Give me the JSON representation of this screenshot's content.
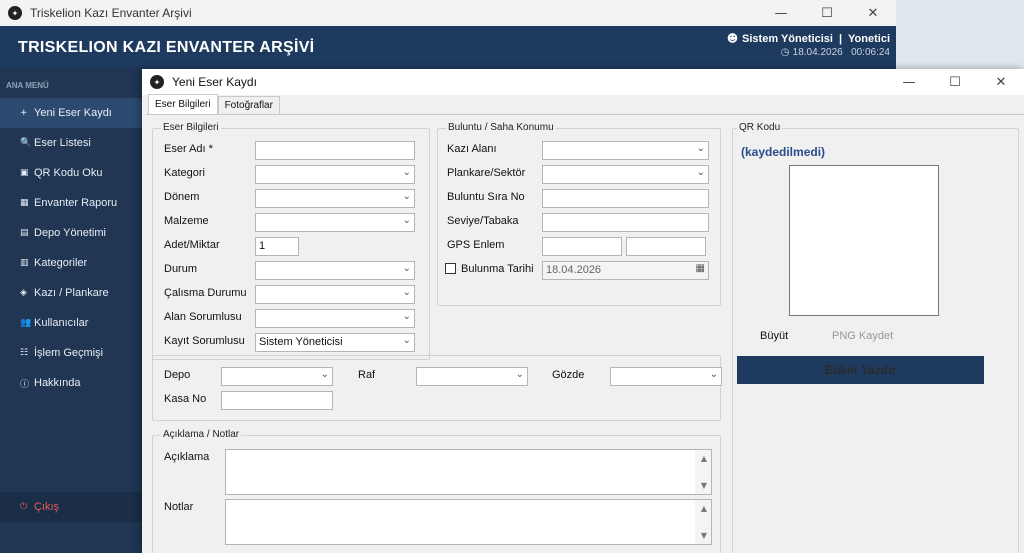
{
  "main_window": {
    "title": "Triskelion Kazı Envanter Arşivi",
    "header_title": "TRISKELION KAZI ENVANTER ARŞİVİ",
    "user_line": "Sistem Yöneticisi  |  Yonetici",
    "date": "18.04.2026",
    "time": "00:06:24",
    "controls": [
      "—",
      "☐",
      "✕"
    ]
  },
  "sidebar": {
    "heading": "ANA MENÜ",
    "items": [
      {
        "icon": "+",
        "label": "Yeni Eser Kaydı"
      },
      {
        "icon": "🔍",
        "label": "Eser Listesi"
      },
      {
        "icon": "▣",
        "label": "QR Kodu Oku"
      },
      {
        "icon": "▦",
        "label": "Envanter Raporu"
      },
      {
        "icon": "▤",
        "label": "Depo Yönetimi"
      },
      {
        "icon": "▥",
        "label": "Kategoriler"
      },
      {
        "icon": "◈",
        "label": "Kazı / Plankare"
      },
      {
        "icon": "👥",
        "label": "Kullanıcılar"
      },
      {
        "icon": "☷",
        "label": "İşlem Geçmişi"
      },
      {
        "icon": "ⓘ",
        "label": "Hakkında"
      }
    ],
    "exit": {
      "icon": "⏻",
      "label": "Çıkış"
    }
  },
  "dialog": {
    "title": "Yeni Eser Kaydı",
    "controls": [
      "—",
      "☐",
      "✕"
    ],
    "tabs": [
      "Eser Bilgileri",
      "Fotoğraflar"
    ],
    "eser_bilgileri": {
      "group_label": "Eser Bilgileri",
      "eser_adi": "Eser Adı *",
      "kategori": "Kategori",
      "donem": "Dönem",
      "malzeme": "Malzeme",
      "adet": "Adet/Miktar",
      "adet_value": "1",
      "durum": "Durum",
      "calisma": "Çalısma Durumu",
      "alan_sorumlusu": "Alan Sorumlusu",
      "kayit_sorumlusu": "Kayıt Sorumlusu",
      "kayit_value": "Sistem Yöneticisi"
    },
    "buluntu": {
      "group_label": "Buluntu / Saha Konumu",
      "kazi_alani": "Kazı Alanı",
      "plankare": "Plankare/Sektör",
      "sira_no": "Buluntu Sıra No",
      "seviye": "Seviye/Tabaka",
      "gps": "GPS Enlem",
      "bulunma_tarihi": "Bulunma Tarihi",
      "date_value": "18.04.2026"
    },
    "depo": {
      "depo": "Depo",
      "raf": "Raf",
      "gozde": "Gözde",
      "kasa_no": "Kasa No"
    },
    "aciklama": {
      "group_label": "Açıklama / Notlar",
      "aciklama": "Açıklama",
      "notlar": "Notlar"
    },
    "qr": {
      "group_label": "QR Kodu",
      "status": "(kaydedilmedi)",
      "buyut": "Büyüt",
      "png": "PNG Kaydet",
      "print": "Etiket Yazdır"
    }
  }
}
